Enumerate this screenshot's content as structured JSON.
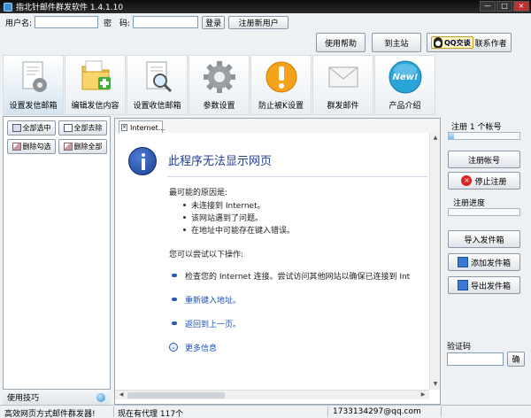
{
  "titlebar": {
    "title": "指北针邮件群发软件 1.4.1.10",
    "min": "—",
    "max": "□",
    "close": "×"
  },
  "login": {
    "username_label": "用户名:",
    "password_label": "密　码:",
    "username_value": "",
    "password_value": "",
    "login_button": "登录",
    "register_button": "注册新用户"
  },
  "topbar": {
    "help_button": "使用帮助",
    "home_button": "到主站",
    "qq_badge": "QQ交谈",
    "contact_label": "联系作者"
  },
  "toolbar": {
    "items": [
      {
        "label": "设置发信邮箱",
        "icon": "document-gear-icon"
      },
      {
        "label": "编辑发信内容",
        "icon": "folder-plus-icon"
      },
      {
        "label": "设置收信邮箱",
        "icon": "document-search-icon"
      },
      {
        "label": "参数设置",
        "icon": "gear-icon"
      },
      {
        "label": "防止被K设置",
        "icon": "warning-icon"
      },
      {
        "label": "群发邮件",
        "icon": "envelope-icon"
      },
      {
        "label": "产品介绍",
        "icon": "new-badge-icon",
        "badge_text": "New!"
      }
    ]
  },
  "left": {
    "select_all": "全部选中",
    "deselect_all": "全部去除",
    "delete_checked": "删除勾选",
    "delete_all": "删除全部",
    "tips": "使用技巧"
  },
  "browser": {
    "tab_label": "Internet...",
    "tab_close": "×",
    "title": "此程序无法显示网页",
    "causes_heading": "最可能的原因是:",
    "causes": [
      "未连接到 Internet。",
      "该网站遇到了问题。",
      "在地址中可能存在键入错误。"
    ],
    "actions_heading": "您可以尝试以下操作:",
    "actions": [
      "检查您的 Internet 连接。尝试访问其他网站以确保已连接到 Int",
      "重新键入地址。",
      "返回到上一页。"
    ],
    "more_info": "更多信息",
    "more_glyph": "⌄",
    "arrow_up": "▲",
    "arrow_down": "▼",
    "arrow_left": "◀",
    "arrow_right": "▶"
  },
  "right": {
    "registered_accounts": "注册 1 个帐号",
    "register_account_button": "注册帐号",
    "stop_register_button": "停止注册",
    "stop_glyph": "×",
    "register_progress_label": "注册进度",
    "register_progress": 0.0,
    "top_progress": 0.08,
    "import_accounts_button": "导入发件箱",
    "add_account_button": "添加发件箱",
    "export_accounts_button": "导出发件箱",
    "captcha_label": "验证码",
    "captcha_value": "",
    "confirm_button": "确"
  },
  "status": {
    "slogan": "高效网页方式邮件群发器!",
    "proxy": "现在有代理 117个",
    "email": "1733134297@qq.com"
  }
}
